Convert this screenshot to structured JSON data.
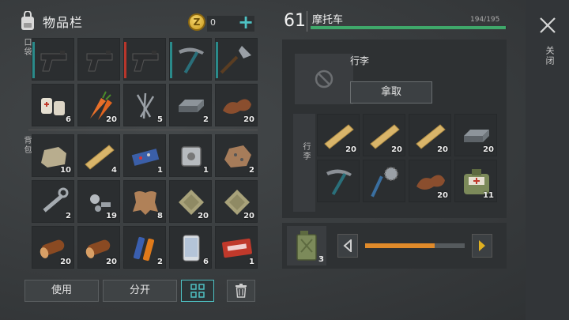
{
  "inventory": {
    "title": "物品栏",
    "coins": "0",
    "pocket_label": "口袋",
    "backpack_label": "背包",
    "pocket": [
      {
        "name": "pistol",
        "count": "",
        "durability": "#2a8a8a"
      },
      {
        "name": "pistol",
        "count": "",
        "durability": ""
      },
      {
        "name": "pistol",
        "count": "",
        "durability": "#b8362b"
      },
      {
        "name": "pickaxe",
        "count": "",
        "durability": "#2a8a8a"
      },
      {
        "name": "shovel",
        "count": "",
        "durability": "#2a8a8a"
      },
      {
        "name": "bandage",
        "count": "6"
      },
      {
        "name": "carrot",
        "count": "20"
      },
      {
        "name": "nails",
        "count": "5"
      },
      {
        "name": "iron-bar",
        "count": "2"
      },
      {
        "name": "leather",
        "count": "20"
      }
    ],
    "backpack": [
      {
        "name": "stone",
        "count": "10"
      },
      {
        "name": "plank",
        "count": "4"
      },
      {
        "name": "circuit-board",
        "count": "1"
      },
      {
        "name": "engine-part",
        "count": "1"
      },
      {
        "name": "iron-ore",
        "count": "2"
      },
      {
        "name": "wrench",
        "count": "2"
      },
      {
        "name": "bolts",
        "count": "19"
      },
      {
        "name": "hide",
        "count": "8"
      },
      {
        "name": "cloth",
        "count": "20"
      },
      {
        "name": "cloth",
        "count": "20"
      },
      {
        "name": "log",
        "count": "20"
      },
      {
        "name": "log",
        "count": "20"
      },
      {
        "name": "batteries",
        "count": "2"
      },
      {
        "name": "smartphone",
        "count": "6"
      },
      {
        "name": "coupon",
        "count": "1"
      }
    ],
    "use_label": "使用",
    "split_label": "分开"
  },
  "vehicle": {
    "level": "61",
    "name": "摩托车",
    "hp_text": "194/195",
    "hp_fraction": 0.995,
    "luggage_label": "行李",
    "take_label": "拿取",
    "cargo_label": "行李",
    "cargo": [
      {
        "name": "plank",
        "count": "20"
      },
      {
        "name": "plank",
        "count": "20"
      },
      {
        "name": "plank",
        "count": "20"
      },
      {
        "name": "iron-bar",
        "count": "20"
      },
      {
        "name": "pickaxe",
        "count": ""
      },
      {
        "name": "saw-staff",
        "count": ""
      },
      {
        "name": "leather",
        "count": "20"
      },
      {
        "name": "medkit-bag",
        "count": "11"
      }
    ],
    "fuel_count": "3",
    "fuel_fraction": 0.7
  },
  "close_label": "关闭",
  "colors": {
    "accent": "#4ec2c4",
    "hp": "#3fa86a",
    "fuel": "#e08a2a",
    "arrow": "#e0b020"
  }
}
